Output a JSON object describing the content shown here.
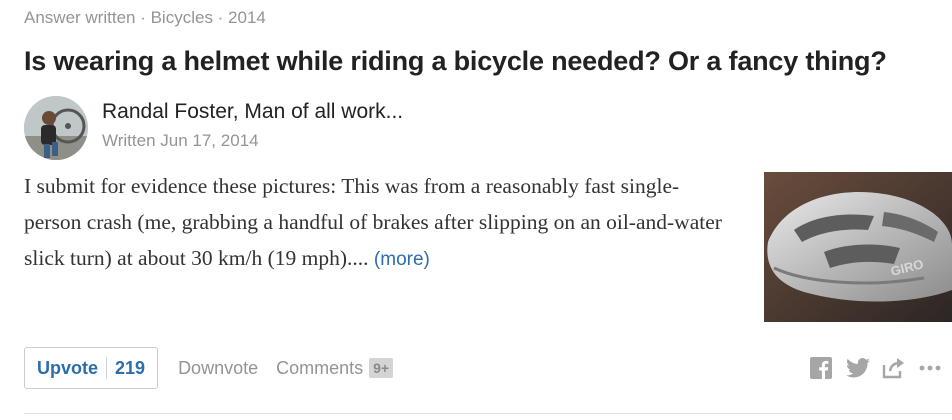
{
  "meta": {
    "prefix": "Answer written · ",
    "topic": "Bicycles",
    "suffix": " · 2014"
  },
  "question": {
    "title": "Is wearing a helmet while riding a bicycle needed? Or a fancy thing?"
  },
  "author": {
    "name": "Randal Foster, Man of all work...",
    "written": "Written Jun 17, 2014"
  },
  "answer": {
    "text": "I submit for evidence these pictures: This was from a reasonably fast single-person crash (me, grabbing a handful of brakes after slipping on an oil-and-water slick turn) at about 30 km/h (19 mph)....",
    "more_label": "(more)"
  },
  "photo": {
    "brand_text": "GIRO"
  },
  "actions": {
    "upvote_label": "Upvote",
    "upvote_count": "219",
    "downvote_label": "Downvote",
    "comments_label": "Comments",
    "comments_badge": "9+"
  },
  "share": {
    "icons": [
      "facebook-icon",
      "twitter-icon",
      "share-icon",
      "more-icon"
    ]
  },
  "colors": {
    "link": "#2b6dad",
    "muted": "#949494",
    "title": "#222222"
  }
}
